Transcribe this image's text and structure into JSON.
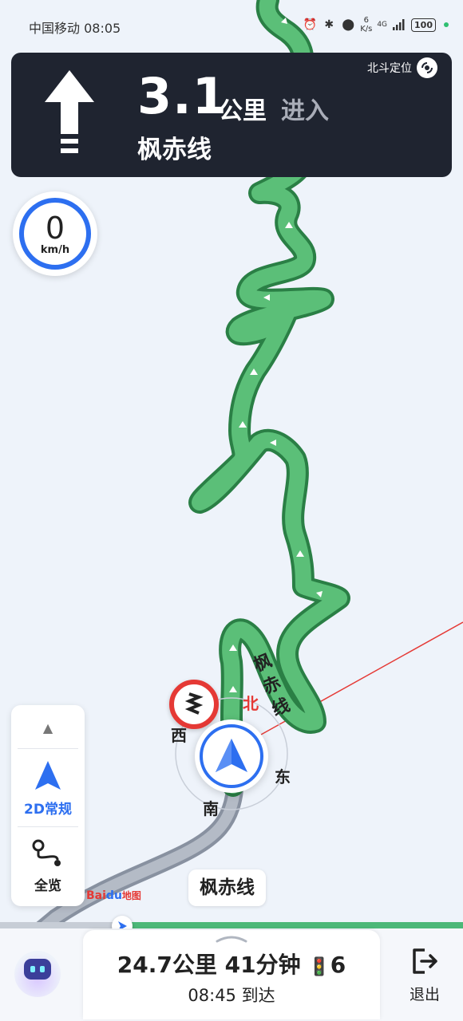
{
  "status_bar": {
    "carrier_time": "中国移动 08:05",
    "net_speed_value": "6",
    "net_speed_unit": "K/s",
    "network": "4G",
    "battery": "100",
    "icons": [
      "alarm-icon",
      "bluetooth-icon",
      "location-icon",
      "signal-icon"
    ]
  },
  "nav": {
    "distance_value": "3.1",
    "distance_unit": "公里",
    "action": "进入",
    "road": "枫赤线",
    "maneuver_icon": "straight-arrow-icon",
    "positioning": "北斗定位"
  },
  "speed": {
    "value": "0",
    "unit": "km/h"
  },
  "map": {
    "road_label": "枫赤线",
    "road_label_vertical": [
      "枫",
      "赤",
      "线"
    ],
    "compass": {
      "north": "北",
      "south": "南",
      "east": "东",
      "west": "西"
    },
    "route_color": "#49a864",
    "traveled_color": "#9aa3b0",
    "heading_line_color": "#e53935"
  },
  "side_panel": {
    "mode_label": "2D常规",
    "overview_label": "全览"
  },
  "brand": {
    "bai": "Bai",
    "du": "du",
    "map": "地图"
  },
  "route_progress": 0.27,
  "trip": {
    "remaining_distance": "24.7公里",
    "remaining_time": "41分钟",
    "traffic_lights": "6",
    "arrival": "08:45 到达"
  },
  "exit_label": "退出"
}
